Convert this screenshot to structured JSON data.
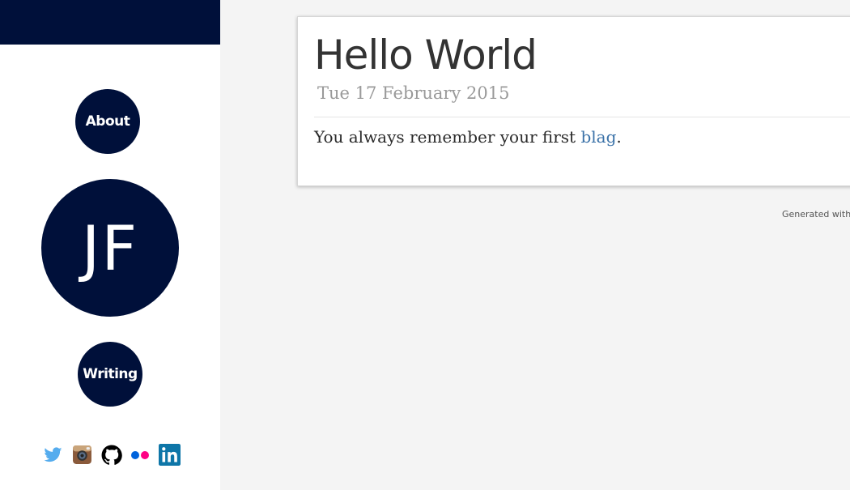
{
  "sidebar": {
    "band_color": "#00103a",
    "about_label": "About",
    "monogram": "JF",
    "writing_label": "Writing",
    "social": [
      {
        "icon": "twitter-icon",
        "color": "#55acee"
      },
      {
        "icon": "instagram-icon",
        "color": "#8a5a3b"
      },
      {
        "icon": "github-icon",
        "color": "#000000"
      },
      {
        "icon": "flickr-icon",
        "color": "#ff0084"
      },
      {
        "icon": "linkedin-icon",
        "color": "#0e76a8"
      }
    ]
  },
  "post": {
    "title": "Hello World",
    "date": "Tue 17 February 2015",
    "body_before": "You always remember your first ",
    "body_link": "blag",
    "body_after": "."
  },
  "footer": {
    "text": "Generated with P"
  },
  "colors": {
    "navy": "#00103a",
    "link": "#3b72a8",
    "background": "#f4f4f4"
  }
}
